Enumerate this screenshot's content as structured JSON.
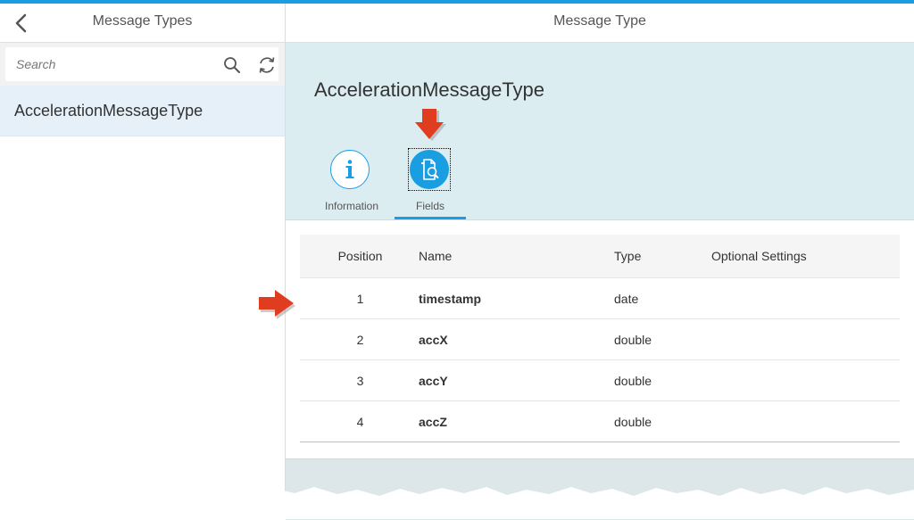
{
  "master": {
    "title": "Message Types",
    "search_placeholder": "Search",
    "items": [
      {
        "label": "AccelerationMessageType"
      }
    ]
  },
  "detail": {
    "title": "Message Type",
    "object_title": "AccelerationMessageType",
    "tabs": [
      {
        "label": "Information",
        "icon": "info-icon"
      },
      {
        "label": "Fields",
        "icon": "document-search-icon",
        "selected": true
      }
    ],
    "table": {
      "columns": [
        "Position",
        "Name",
        "Type",
        "Optional Settings"
      ],
      "rows": [
        {
          "position": "1",
          "name": "timestamp",
          "type": "date",
          "optional": ""
        },
        {
          "position": "2",
          "name": "accX",
          "type": "double",
          "optional": ""
        },
        {
          "position": "3",
          "name": "accY",
          "type": "double",
          "optional": ""
        },
        {
          "position": "4",
          "name": "accZ",
          "type": "double",
          "optional": ""
        }
      ]
    }
  },
  "colors": {
    "accent": "#1a9ee2",
    "header_bg": "#dcedf2",
    "selected_item_bg": "#e5f0f8",
    "annotation_arrow": "#e03c1f"
  }
}
